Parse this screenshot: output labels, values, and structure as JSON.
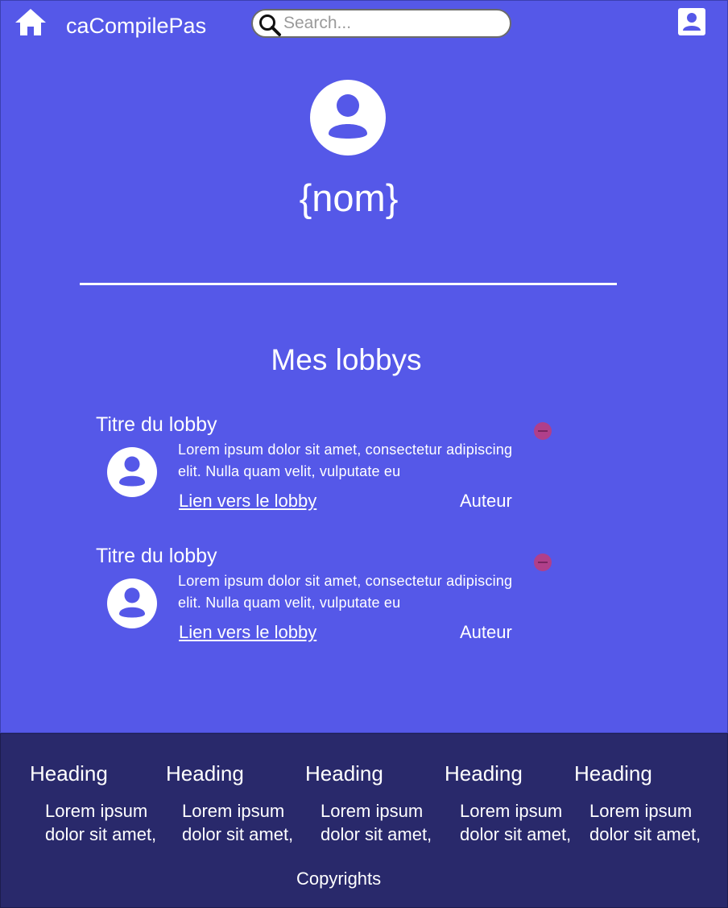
{
  "header": {
    "app_title": "caCompilePas",
    "search_placeholder": "Search...",
    "icons": [
      "home-icon",
      "search-icon",
      "account-icon"
    ]
  },
  "profile": {
    "name": "{nom}",
    "avatar_icon": "user-avatar-icon"
  },
  "lobbies_section": {
    "title": "Mes lobbys",
    "items": [
      {
        "title": "Titre du lobby",
        "description": "Lorem ipsum dolor sit amet, consectetur adipiscing elit. Nulla quam velit, vulputate eu",
        "link_label": "Lien vers le lobby",
        "author": "Auteur"
      },
      {
        "title": "Titre du lobby",
        "description": "Lorem ipsum dolor sit amet, consectetur adipiscing elit. Nulla quam velit, vulputate eu",
        "link_label": "Lien vers le lobby",
        "author": "Auteur"
      }
    ]
  },
  "footer": {
    "columns": [
      {
        "heading": "Heading",
        "text": "Lorem ipsum dolor sit amet,"
      },
      {
        "heading": "Heading",
        "text": "Lorem ipsum dolor sit amet,"
      },
      {
        "heading": "Heading",
        "text": "Lorem ipsum dolor sit amet,"
      },
      {
        "heading": "Heading",
        "text": "Lorem ipsum dolor sit amet,"
      },
      {
        "heading": "Heading",
        "text": "Lorem ipsum dolor sit amet,"
      }
    ],
    "copyright": "Copyrights"
  },
  "colors": {
    "main_background": "#5558e8",
    "footer_background": "#29296b",
    "remove_button": "#b03f8a",
    "text": "#ffffff"
  }
}
